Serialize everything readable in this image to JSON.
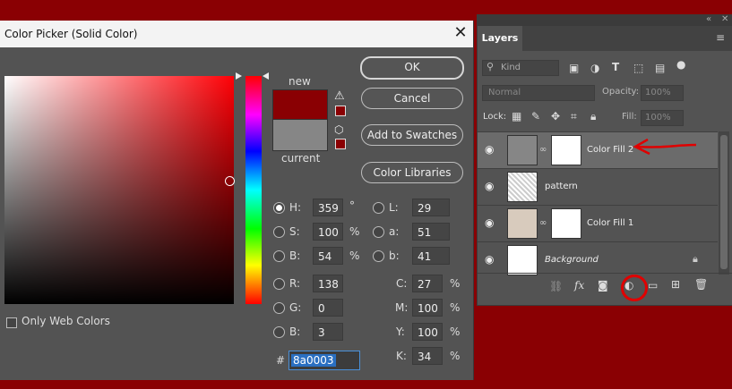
{
  "picker": {
    "title": "Color Picker (Solid Color)",
    "close_glyph": "✕",
    "new_label": "new",
    "current_label": "current",
    "buttons": {
      "ok": "OK",
      "cancel": "Cancel",
      "add_swatches": "Add to Swatches",
      "color_libraries": "Color Libraries"
    },
    "hsb": {
      "h_label": "H:",
      "h": "359",
      "h_unit": "°",
      "s_label": "S:",
      "s": "100",
      "s_unit": "%",
      "b_label": "B:",
      "b": "54",
      "b_unit": "%"
    },
    "rgb": {
      "r_label": "R:",
      "r": "138",
      "g_label": "G:",
      "g": "0",
      "b_label": "B:",
      "b": "3"
    },
    "lab": {
      "l_label": "L:",
      "l": "29",
      "a_label": "a:",
      "a": "51",
      "b_label": "b:",
      "b": "41"
    },
    "cmyk": {
      "c_label": "C:",
      "c": "27",
      "m_label": "M:",
      "m": "100",
      "y_label": "Y:",
      "y": "100",
      "k_label": "K:",
      "k": "34",
      "unit": "%"
    },
    "hex_label": "#",
    "hex": "8a0003",
    "only_web_colors": "Only Web Colors"
  },
  "layers_panel": {
    "tab": "Layers",
    "collapse_glyph": "«",
    "close_glyph": "✕",
    "menu_glyph": "≡",
    "kind_placeholder": "Kind",
    "blend_mode": "Normal",
    "opacity_label": "Opacity:",
    "opacity": "100%",
    "lock_label": "Lock:",
    "fill_label": "Fill:",
    "fill": "100%",
    "layers": [
      {
        "name": "Color Fill 2",
        "selected": true
      },
      {
        "name": "pattern",
        "selected": false
      },
      {
        "name": "Color Fill 1",
        "selected": false
      },
      {
        "name": "Background",
        "selected": false
      }
    ]
  },
  "colors": {
    "accent": "#8a0003",
    "annotation": "#e00000"
  }
}
